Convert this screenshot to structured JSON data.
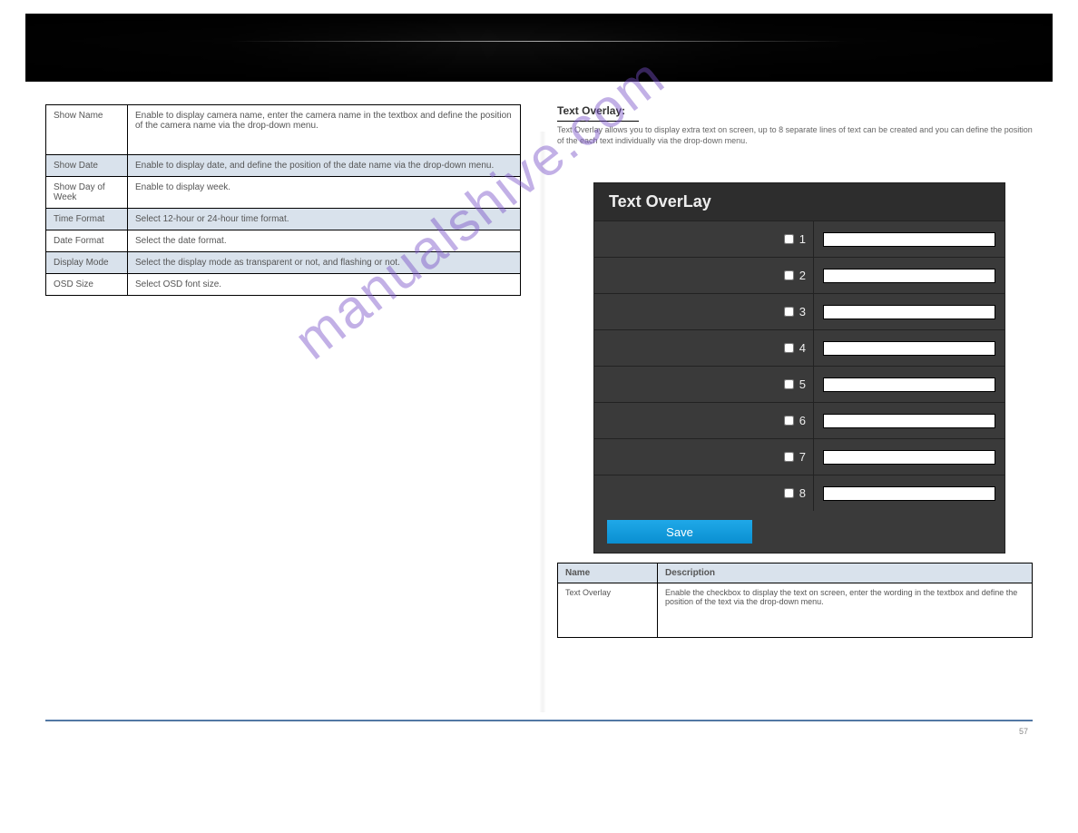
{
  "leftTable": {
    "rows": [
      {
        "label": "Show Name",
        "desc": "Enable to display camera name, enter the camera name in the textbox and define the position of the camera name via the drop-down menu."
      },
      {
        "label": "Show Date",
        "desc": "Enable to display date, and define the position of the date name via the drop-down menu."
      },
      {
        "label": "Show Day of Week",
        "desc": "Enable to display week."
      },
      {
        "label": "Time Format",
        "desc": "Select 12-hour or 24-hour time format."
      },
      {
        "label": "Date Format",
        "desc": "Select the date format."
      },
      {
        "label": "Display Mode",
        "desc": "Select the display mode as transparent or not, and flashing or not."
      },
      {
        "label": "OSD Size",
        "desc": "Select OSD font size."
      }
    ]
  },
  "right": {
    "heading": "Text Overlay:",
    "subtext": "Text Overlay allows you to display extra text on screen, up to 8 separate lines of text can be created and you can define the position of the each text individually via the drop-down menu.",
    "widgetTitle": "Text OverLay",
    "rows": [
      "1",
      "2",
      "3",
      "4",
      "5",
      "6",
      "7",
      "8"
    ],
    "saveLabel": "Save"
  },
  "descTable": {
    "head": [
      "Name",
      "Description"
    ],
    "row": {
      "label": "Text Overlay",
      "desc": "Enable the checkbox to display the text on screen, enter the wording in the textbox and define the position of the text via the drop-down menu."
    }
  },
  "watermark": "manualshive.com",
  "pageNumber": "57"
}
